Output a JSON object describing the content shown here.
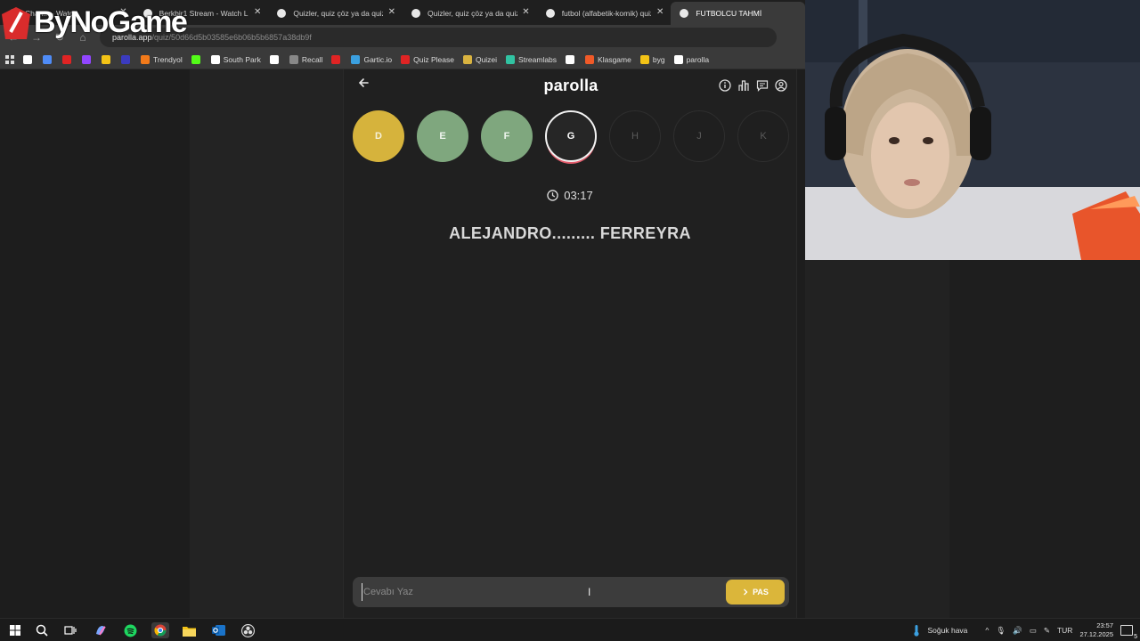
{
  "overlay": {
    "logo_text": "ByNoGame"
  },
  "browser": {
    "tabs": [
      {
        "label": "Chan... - Watch",
        "active": false
      },
      {
        "label": "Berkbir1 Stream - Watch Live o",
        "active": false
      },
      {
        "label": "Quizler, quiz çöz ya da quiz olu",
        "active": false
      },
      {
        "label": "Quizler, quiz çöz ya da quiz olu",
        "active": false
      },
      {
        "label": "futbol (alfabetik-komik) quiz - ",
        "active": false
      },
      {
        "label": "FUTBOLCU TAHMİ",
        "active": true
      }
    ],
    "address": {
      "host": "parolla.app",
      "path": "/quiz/50d66d5b03585e6b06b5b6857a38db9f"
    },
    "bookmarks": [
      {
        "label": "",
        "color": "#ffffff"
      },
      {
        "label": "",
        "color": "#4f8cf7"
      },
      {
        "label": "",
        "color": "#e02424"
      },
      {
        "label": "",
        "color": "#9146ff"
      },
      {
        "label": "",
        "color": "#f3c316"
      },
      {
        "label": "",
        "color": "#3b3bbf"
      },
      {
        "label": "Trendyol",
        "color": "#f27a1a"
      },
      {
        "label": "",
        "color": "#53fc18"
      },
      {
        "label": "South Park",
        "color": "#ffffff"
      },
      {
        "label": "",
        "color": "#ffffff"
      },
      {
        "label": "Recall",
        "color": "#888888"
      },
      {
        "label": "",
        "color": "#e02424"
      },
      {
        "label": "Gartic.io",
        "color": "#3ba0e0"
      },
      {
        "label": "Quiz Please",
        "color": "#e02424"
      },
      {
        "label": "Quizei",
        "color": "#d9b340"
      },
      {
        "label": "Streamlabs",
        "color": "#31c3a2"
      },
      {
        "label": "",
        "color": "#ffffff"
      },
      {
        "label": "Klasgame",
        "color": "#f05a28"
      },
      {
        "label": "byg",
        "color": "#f3c316"
      },
      {
        "label": "parolla",
        "color": "#ffffff"
      }
    ]
  },
  "app": {
    "title": "parolla",
    "letters": [
      {
        "char": "D",
        "state": "answered-yellow"
      },
      {
        "char": "E",
        "state": "answered-green"
      },
      {
        "char": "F",
        "state": "answered-green"
      },
      {
        "char": "G",
        "state": "current"
      },
      {
        "char": "H",
        "state": "pending"
      },
      {
        "char": "J",
        "state": "pending"
      },
      {
        "char": "K",
        "state": "pending"
      }
    ],
    "timer": "03:17",
    "question": "ALEJANDRO......... FERREYRA",
    "answer_placeholder": "Cevabı Yaz",
    "pass_label": "PAS"
  },
  "taskbar": {
    "weather": "Soğuk hava",
    "lang": "TUR",
    "time": "23:57",
    "date": "27.12.2025",
    "notifications": "5"
  },
  "colors": {
    "accent_yellow": "#d6b33c",
    "accent_green": "#7fa77e",
    "current_ring": "#e25b6b"
  }
}
